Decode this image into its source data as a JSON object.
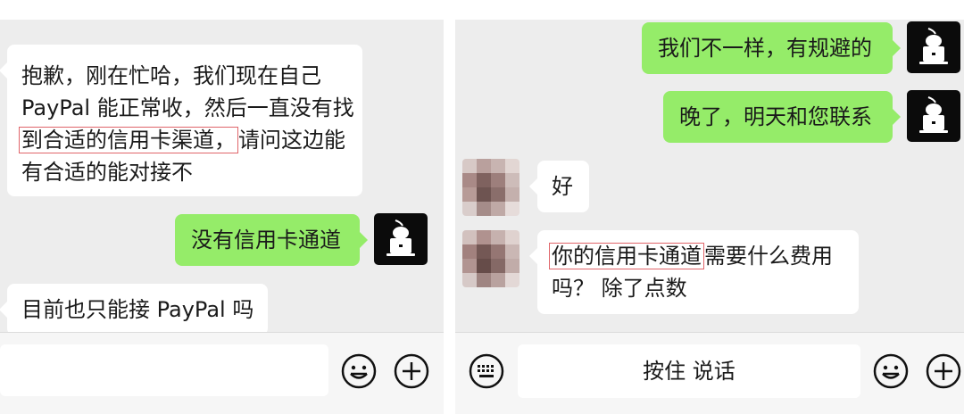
{
  "left_chat": {
    "messages": [
      {
        "sender": "peer",
        "line1": "抱歉，刚在忙哈，我们现在自己",
        "line2": "PayPal 能正常收，然后一直没有找",
        "line3_highlight": "到合适的信用卡渠道，",
        "line3_rest": "请问这边能",
        "line4": "有合适的能对接不"
      },
      {
        "sender": "self",
        "text": "没有信用卡通道"
      },
      {
        "sender": "peer",
        "text": "目前也只能接 PayPal 吗"
      }
    ]
  },
  "right_chat": {
    "messages": [
      {
        "sender": "self",
        "text": "我们不一样，有规避的"
      },
      {
        "sender": "self",
        "text": "晚了，明天和您联系"
      },
      {
        "sender": "peer",
        "text": "好"
      },
      {
        "sender": "peer",
        "line1_highlight": "你的信用卡通道",
        "line1_rest": "需要什么费用",
        "line2": "吗？ 除了点数"
      }
    ],
    "input": {
      "hold_to_talk_label": "按住 说话"
    }
  },
  "icons": {
    "emoji": "emoji-icon",
    "plus": "plus-icon",
    "keyboard": "keyboard-icon",
    "self_avatar": "laptop-avatar"
  },
  "colors": {
    "chat_background": "#ededed",
    "outgoing_bubble": "#95ec69",
    "incoming_bubble": "#ffffff",
    "highlight_box": "#e0656a",
    "avatar_background": "#0b0b0b"
  }
}
